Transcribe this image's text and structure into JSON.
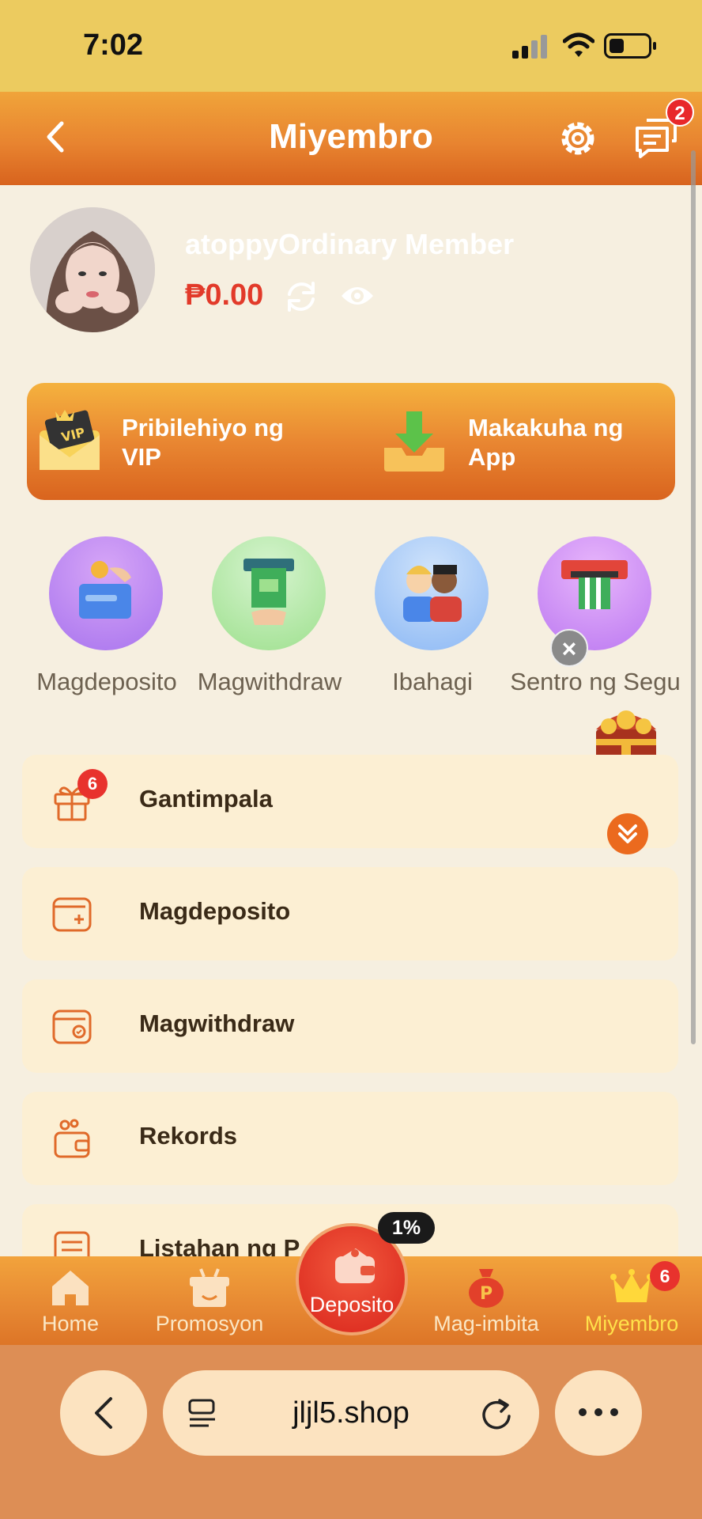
{
  "status_bar": {
    "time": "7:02"
  },
  "header": {
    "title": "Miyembro",
    "message_badge": "2"
  },
  "profile": {
    "username": "atoppyOrdinary Member",
    "balance": "₱0.00"
  },
  "banner": {
    "vip_label": "Pribilehiyo ng VIP",
    "app_label": "Makakuha ng App"
  },
  "quick_actions": [
    {
      "label": "Magdeposito",
      "icon": "deposit-card-icon"
    },
    {
      "label": "Magwithdraw",
      "icon": "atm-withdraw-icon"
    },
    {
      "label": "Ibahagi",
      "icon": "share-people-icon"
    },
    {
      "label": "Sentro ng Segu",
      "icon": "security-center-icon"
    }
  ],
  "menu": [
    {
      "label": "Gantimpala",
      "icon": "gift-icon",
      "badge": "6"
    },
    {
      "label": "Magdeposito",
      "icon": "wallet-add-icon"
    },
    {
      "label": "Magwithdraw",
      "icon": "wallet-check-icon"
    },
    {
      "label": "Rekords",
      "icon": "wallet-coins-icon"
    },
    {
      "label": "Listahan ng P",
      "icon": "list-icon"
    }
  ],
  "bottom_nav": {
    "items": [
      {
        "label": "Home",
        "icon": "home-icon"
      },
      {
        "label": "Promosyon",
        "icon": "gift-box-icon"
      },
      {
        "label": "Deposito",
        "icon": "wallet-icon"
      },
      {
        "label": "Mag-imbita",
        "icon": "money-bag-icon"
      },
      {
        "label": "Miyembro",
        "icon": "crown-icon"
      }
    ],
    "deposit_percent": "1%",
    "member_badge": "6",
    "active_color": "#ffe14a"
  },
  "browser": {
    "url": "jljl5.shop"
  },
  "colors": {
    "accent": "#e8822f",
    "badge": "#e8322d",
    "balance": "#e23a2a"
  }
}
